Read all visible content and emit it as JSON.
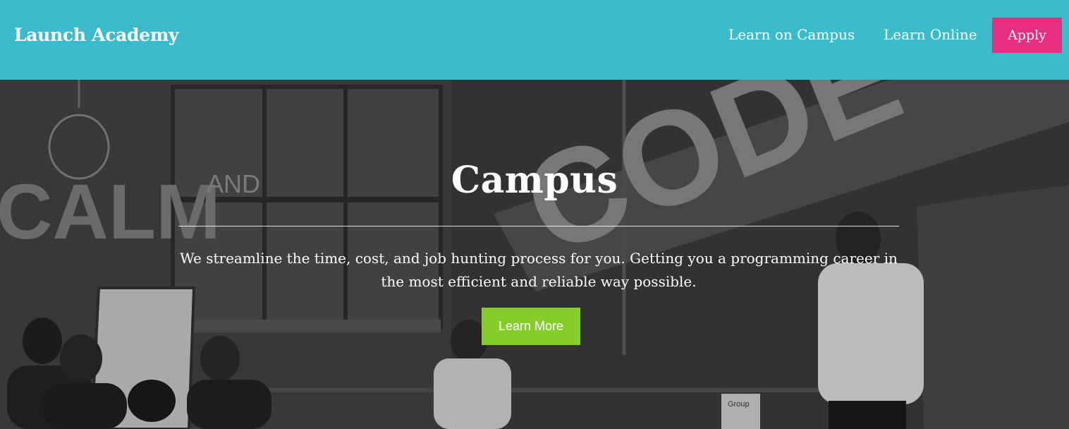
{
  "header": {
    "brand": "Launch Academy",
    "nav": [
      {
        "label": "Learn on Campus"
      },
      {
        "label": "Learn Online"
      }
    ],
    "apply_label": "Apply"
  },
  "hero": {
    "title": "Campus",
    "description": "We streamline the time, cost, and job hunting process for you. Getting you a programming career in the most efficient and reliable way possible.",
    "cta_label": "Learn More",
    "background_text": {
      "wall_left": "CALM",
      "window_sign": "AND",
      "wall_right": "CODE",
      "sign": "Group"
    }
  },
  "colors": {
    "header_bg": "#3bbccc",
    "apply_bg": "#e82f7f",
    "cta_bg": "#86cc2b"
  }
}
